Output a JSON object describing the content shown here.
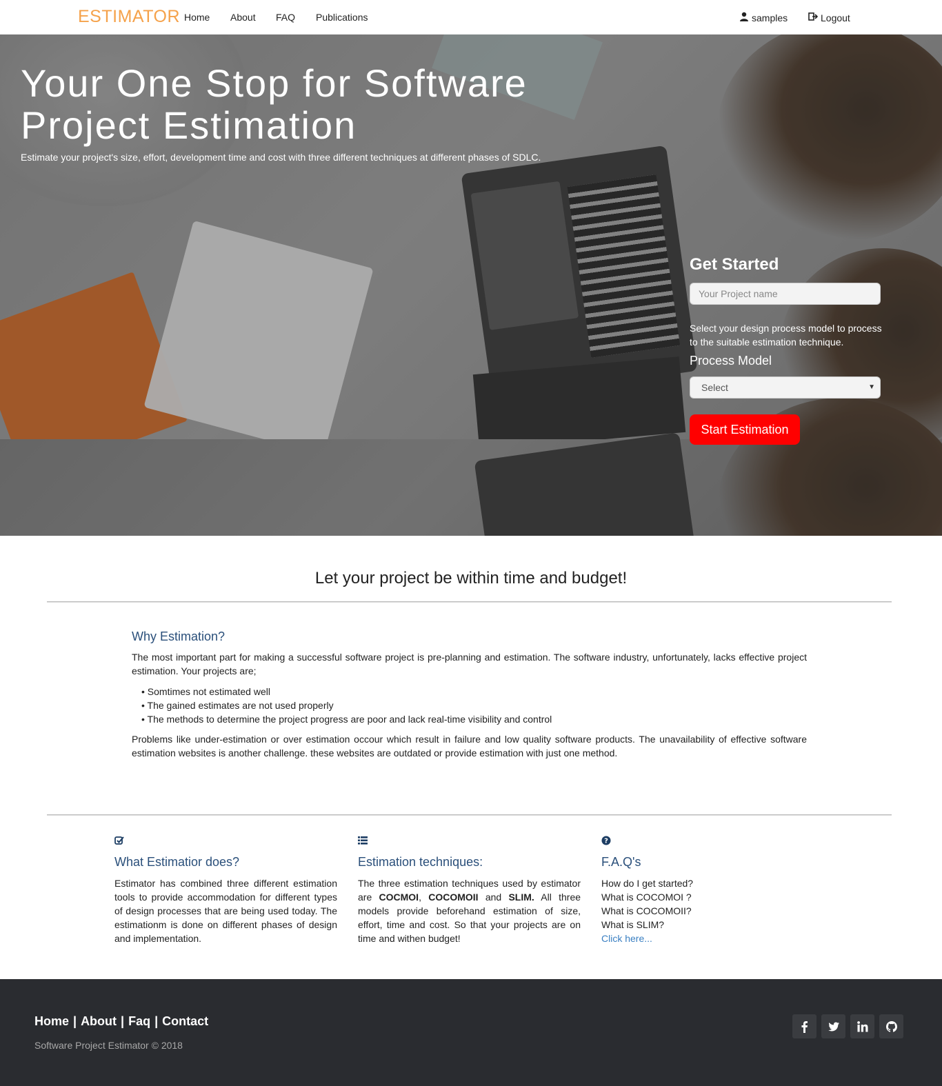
{
  "navbar": {
    "logo": "ESTIMATOR",
    "links": [
      "Home",
      "About",
      "FAQ",
      "Publications"
    ],
    "user": "samples",
    "logout": "Logout"
  },
  "hero": {
    "title": "Your One Stop for Software Project Estimation",
    "subtitle": "Estimate your project's size, effort, development time and cost with three different techniques at different phases of SDLC.",
    "get_started": {
      "title": "Get Started",
      "project_placeholder": "Your Project name",
      "description": "Select your design process model to process to the suitable estimation technique.",
      "process_label": "Process Model",
      "select_value": "Select",
      "button": "Start Estimation",
      "button_color": "#ff0000"
    }
  },
  "main": {
    "tagline": "Let your project be within time and budget!",
    "why": {
      "title": "Why Estimation?",
      "intro": "The most important part for making a successful software project is pre-planning and estimation. The software industry, unfortunately, lacks effective project estimation. Your projects are;",
      "bullets": [
        "• Somtimes not estimated well",
        "• The gained estimates are not used properly",
        "• The methods to determine the project progress are poor and lack real-time visibility and control"
      ],
      "outro": "Problems like under-estimation or over estimation occour which result in failure and low quality software products. The unavailability of effective software estimation websites is another challenge. these websites are outdated or provide estimation with just one method."
    },
    "columns": [
      {
        "icon": "check-square-icon",
        "title": "What Estimatior does?",
        "text": "Estimator has combined three different estimation tools to provide accommodation for different types of design processes that are being used today. The estimationm is done on different phases of design and implementation."
      },
      {
        "icon": "list-icon",
        "title": "Estimation techniques:",
        "text_parts": [
          "The three estimation techniques used by estimator are ",
          "COCMOI",
          ", ",
          "COCOMOII",
          " and ",
          "SLIM.",
          " All three models provide beforehand estimation of size, effort, time and cost. So that your projects are on time and withen budget!"
        ]
      },
      {
        "icon": "question-circle-icon",
        "title": "F.A.Q's",
        "lines": [
          "How do I get started?",
          "What is COCOMOI ?",
          "What is COCOMOII?",
          "What is SLIM?"
        ],
        "link": "Click here..."
      }
    ]
  },
  "footer": {
    "links": [
      "Home",
      "About",
      "Faq",
      "Contact"
    ],
    "separator": "|",
    "copyright": "Software Project Estimator © 2018",
    "social": [
      {
        "icon": "facebook-icon",
        "glyph": "f"
      },
      {
        "icon": "twitter-icon",
        "glyph": "t"
      },
      {
        "icon": "linkedin-icon",
        "glyph": "in"
      },
      {
        "icon": "github-icon",
        "glyph": "◉"
      }
    ]
  },
  "colors": {
    "logo": "#f5a24b",
    "heading_blue": "#2a4f7a",
    "link_blue": "#3a7fc2",
    "footer_bg": "#2a2c30"
  }
}
